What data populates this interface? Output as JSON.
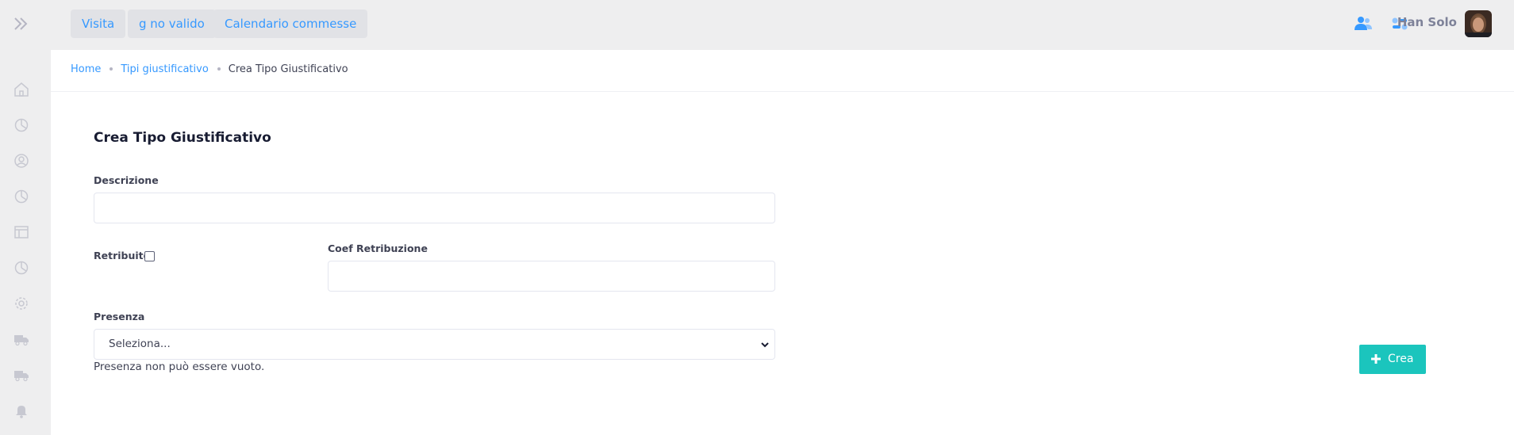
{
  "header": {
    "quick_links": [
      "Visita",
      "g no valido",
      "Calendario commesse"
    ],
    "user_name": "Han Solo",
    "icons": [
      "users-icon",
      "toggle-icon"
    ]
  },
  "sidebar": {
    "items": [
      "home-icon",
      "chart-icon",
      "user-circle-icon",
      "chart-icon",
      "table-icon",
      "chart-icon",
      "gear-icon",
      "truck-icon",
      "truck-icon",
      "bell-icon"
    ]
  },
  "breadcrumb": {
    "home": "Home",
    "parent": "Tipi giustificativo",
    "current": "Crea Tipo Giustificativo"
  },
  "form": {
    "title": "Crea Tipo Giustificativo",
    "descrizione_label": "Descrizione",
    "descrizione_value": "",
    "retribuito_label": "Retribuito",
    "retribuito_checked": false,
    "coef_label": "Coef Retribuzione",
    "coef_value": "",
    "presenza_label": "Presenza",
    "presenza_selected": "Seleziona...",
    "presenza_error": "Presenza non può essere vuoto."
  },
  "actions": {
    "create_label": "Crea"
  },
  "colors": {
    "accent": "#3699ff",
    "create_button": "#1bc5bd",
    "background": "#eeeeef"
  }
}
